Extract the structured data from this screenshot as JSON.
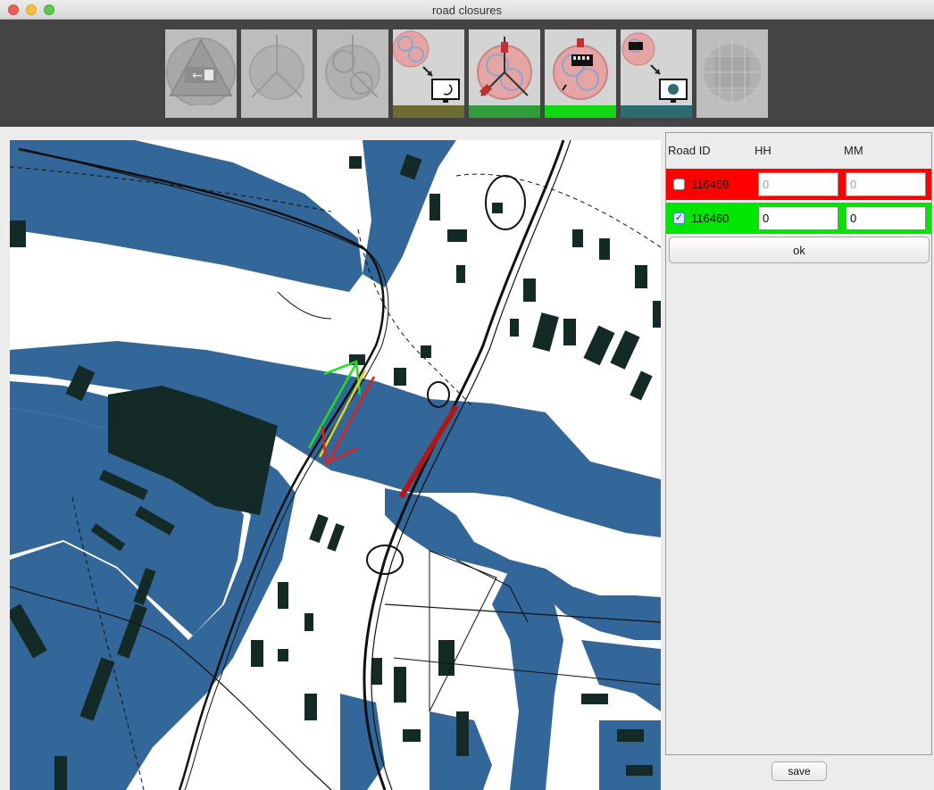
{
  "window": {
    "title": "road closures"
  },
  "toolbar": {
    "tools": [
      {
        "name": "evacuation-tool",
        "bar_color": "#bdbdbd",
        "active": false
      },
      {
        "name": "network-tool",
        "bar_color": "#bdbdbd",
        "active": false
      },
      {
        "name": "routing-tool",
        "bar_color": "#bdbdbd",
        "active": false
      },
      {
        "name": "monitor-tool",
        "bar_color": "#6b6b32",
        "active": true
      },
      {
        "name": "road-closure-tool",
        "bar_color": "#2f9e3a",
        "active": true
      },
      {
        "name": "bus-tool",
        "bar_color": "#12d712",
        "active": true
      },
      {
        "name": "bus-monitor-tool",
        "bar_color": "#2d6b72",
        "active": true
      },
      {
        "name": "grid-tool",
        "bar_color": "#bdbdbd",
        "active": false
      }
    ]
  },
  "panel": {
    "headers": {
      "road_id": "Road ID",
      "hh": "HH",
      "mm": "MM"
    },
    "rows": [
      {
        "road_id": "116459",
        "checked": false,
        "hh": "0",
        "mm": "0",
        "row_color": "#ff0000",
        "enabled": false
      },
      {
        "road_id": "116460",
        "checked": true,
        "hh": "0",
        "mm": "0",
        "row_color": "#00e600",
        "enabled": true
      }
    ],
    "ok_label": "ok"
  },
  "save_label": "save",
  "colors": {
    "water": "#336699",
    "building": "#142a26",
    "toolbar_bg": "#444444"
  }
}
